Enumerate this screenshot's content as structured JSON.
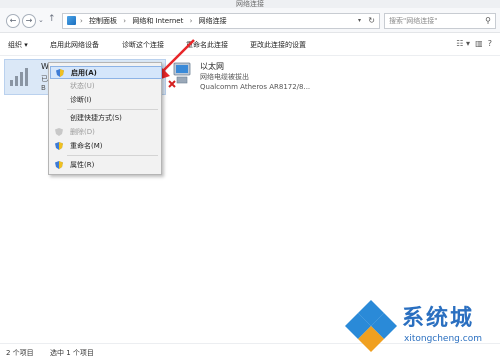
{
  "window": {
    "title": "网络连接"
  },
  "address": {
    "back": "←",
    "forward": "→",
    "dropdown": "⌄",
    "up": "↑",
    "crumbs": [
      "控制面板",
      "网络和 Internet",
      "网络连接"
    ],
    "sep": "›",
    "search_placeholder": "搜索\"网络连接\""
  },
  "toolbar": {
    "organize": "组织 ▾",
    "items": [
      "启用此网络设备",
      "诊断这个连接",
      "重命名此连接",
      "更改此连接的设置"
    ]
  },
  "connections": {
    "wlan": {
      "name": "WLAN",
      "line1": "已",
      "line2": "B"
    },
    "ethernet": {
      "name": "以太网",
      "status": "网络电缆被拔出",
      "adapter": "Qualcomm Atheros AR8172/8..."
    }
  },
  "context_menu": {
    "items": [
      {
        "label": "启用(A)",
        "state": "highlighted",
        "shield": true
      },
      {
        "label": "状态(U)",
        "state": "disabled",
        "shield": false
      },
      {
        "label": "诊断(I)",
        "state": "normal",
        "shield": false
      },
      {
        "label": "创建快捷方式(S)",
        "state": "normal",
        "shield": false
      },
      {
        "label": "删除(D)",
        "state": "disabled",
        "shield": true
      },
      {
        "label": "重命名(M)",
        "state": "normal",
        "shield": true
      },
      {
        "label": "属性(R)",
        "state": "normal",
        "shield": true
      }
    ]
  },
  "status_bar": {
    "count": "2 个项目",
    "selected": "选中 1 个项目"
  },
  "watermark": {
    "brand": "系统城",
    "url": "xitongcheng.com"
  },
  "colors": {
    "accent": "#2a6fc0",
    "selection": "#dbe8f7",
    "arrow": "#e8262a"
  }
}
